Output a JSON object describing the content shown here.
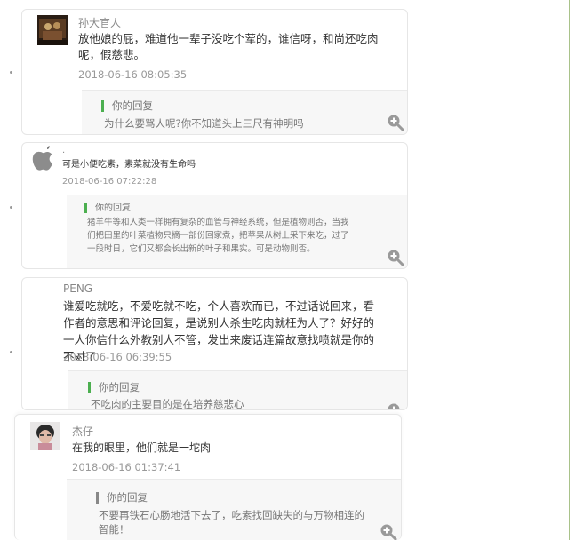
{
  "comments": [
    {
      "author": "孙大官人",
      "content": "放他娘的屁，难道他一辈子没吃个荤的，谁信呀，和尚还吃肉呢，假慈悲。",
      "time": "2018-06-16 08:05:35",
      "reply_label": "你的回复",
      "reply_text": "为什么要骂人呢?你不知道头上三尺有神明吗"
    },
    {
      "author": ".",
      "content": "可是小便吃素，素菜就没有生命吗",
      "time": "2018-06-16 07:22:28",
      "reply_label": "你的回复",
      "reply_text": "猪羊牛等和人类一样拥有复杂的血管与神经系统，但是植物则否，当我们把田里的叶菜植物只摘一部份回家煮，把苹果从树上采下来吃，过了一段时日，它们又都会长出新的叶子和果实。可是动物则否。"
    },
    {
      "author": "PENG",
      "content": "谁爱吃就吃，不爱吃就不吃，个人喜欢而已，不过话说回来，看作者的意思和评论回复，是说别人杀生吃肉就枉为人了？好好的一人你信什么外教别人不管，发出来废话连篇故意找喷就是你的不对了",
      "time": "2018-06-16 06:39:55",
      "reply_label": "你的回复",
      "reply_text": "不吃肉的主要目的是在培养慈悲心"
    },
    {
      "author": "杰仔",
      "content": "在我的眼里，他们就是一坨肉",
      "time": "2018-06-16 01:37:41",
      "reply_label": "你的回复",
      "reply_text": "不要再铁石心肠地活下去了，吃素找回缺失的与万物相连的智能！"
    }
  ],
  "icons": {
    "zoom": "zoom-in-icon",
    "apple": "apple-icon"
  },
  "colors": {
    "accent_green": "#4caf50",
    "page_border": "#a9c28a"
  }
}
